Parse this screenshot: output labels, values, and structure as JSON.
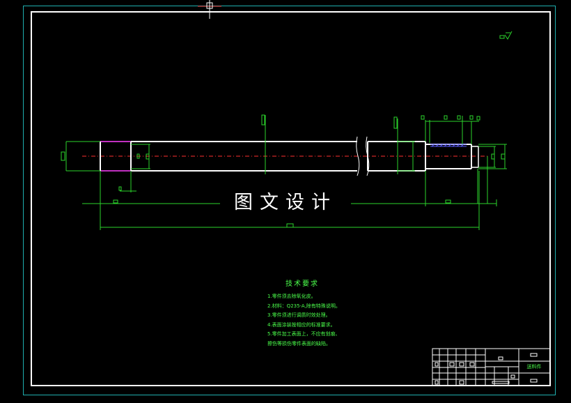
{
  "drawing": {
    "watermark": "图文设计",
    "colors": {
      "background": "#000000",
      "part_outline": "#ffffff",
      "dimension": "#2bd42b",
      "centerline": "#ff3030",
      "frame": "#1fb0b0",
      "highlight": "#ff40ff",
      "hatch": "#5a5aff"
    }
  },
  "tech_requirements": {
    "title": "技术要求",
    "items": [
      "1.零件须去除氧化皮。",
      "2.材料：Q235-A,除有特殊说明。",
      "3.零件须进行调质时效处理。",
      "4.表面涂装按相应的标准要求。",
      "5.零件加工表面上，不应有划痕、",
      "擦伤等损伤零件表面的缺陷。"
    ]
  },
  "title_block": {
    "label": "送料件"
  }
}
